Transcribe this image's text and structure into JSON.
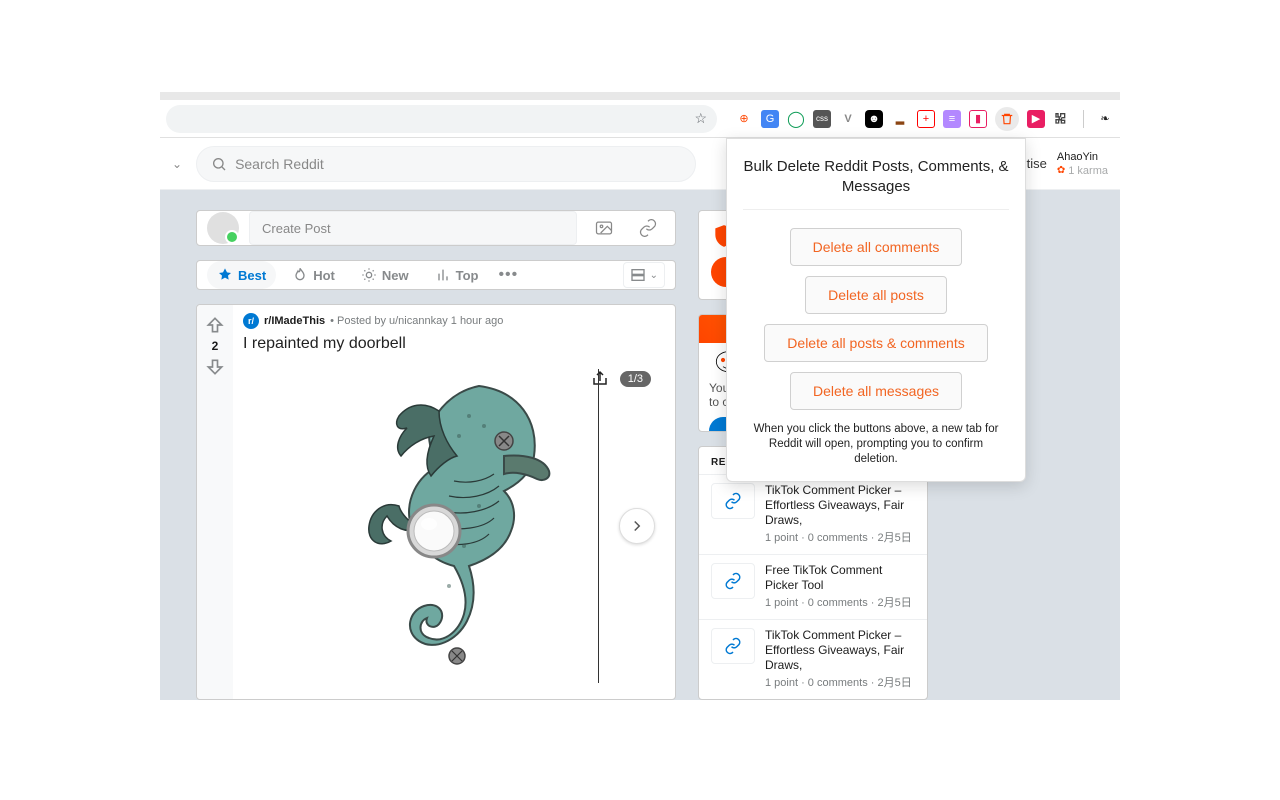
{
  "browser": {
    "extension_icons": [
      "📋",
      "🔤",
      "⭕",
      "▪",
      "V",
      "👤",
      "🟫",
      "➕",
      "📊",
      "📱",
      "🗑",
      "▶",
      "🧩",
      "🍃"
    ]
  },
  "header": {
    "search_placeholder": "Search Reddit",
    "advertise_stub": "tise",
    "user": {
      "name": "AhaoYin",
      "karma": "1 karma"
    }
  },
  "create_post": {
    "placeholder": "Create Post"
  },
  "sort": {
    "items": [
      {
        "label": "Best",
        "active": true
      },
      {
        "label": "Hot",
        "active": false
      },
      {
        "label": "New",
        "active": false
      },
      {
        "label": "Top",
        "active": false
      }
    ]
  },
  "post": {
    "votes": "2",
    "subreddit": "r/IMadeThis",
    "meta": "• Posted by u/nicannkay 1 hour ago",
    "title": "I repainted my doorbell",
    "image_counter": "1/3"
  },
  "snoo": {
    "line1": "Your",
    "line2": "to ch"
  },
  "recent": {
    "header": "RECENT POSTS",
    "items": [
      {
        "title": "TikTok Comment Picker – Effortless Giveaways, Fair Draws,",
        "stats": "1 point · 0 comments · 2月5日"
      },
      {
        "title": "Free TikTok Comment Picker Tool",
        "stats": "1 point · 0 comments · 2月5日"
      },
      {
        "title": "TikTok Comment Picker – Effortless Giveaways, Fair Draws,",
        "stats": "1 point · 0 comments · 2月5日"
      }
    ]
  },
  "extension": {
    "title": "Bulk Delete Reddit Posts, Comments, & Messages",
    "buttons": [
      "Delete all comments",
      "Delete all posts",
      "Delete all posts & comments",
      "Delete all messages"
    ],
    "note": "When you click the buttons above, a new tab for Reddit will open, prompting you to confirm deletion."
  }
}
